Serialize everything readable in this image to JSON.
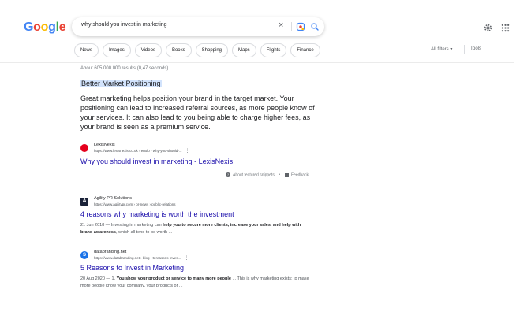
{
  "logo": {
    "text": "Google",
    "letters": [
      "G",
      "o",
      "o",
      "g",
      "l",
      "e"
    ],
    "colors": [
      "#4285f4",
      "#ea4335",
      "#fbbc05",
      "#4285f4",
      "#34a853",
      "#ea4335"
    ]
  },
  "search": {
    "query": "why should you invest in marketing",
    "clear_icon": "×"
  },
  "filters": [
    "News",
    "Images",
    "Videos",
    "Books",
    "Shopping",
    "Maps",
    "Flights",
    "Finance"
  ],
  "toolbar": {
    "all_filters": "All filters ▾",
    "tools": "Tools"
  },
  "stats": "About 605 000 000 results (0,47 seconds)",
  "featured": {
    "highlight": "Better Market Positioning",
    "snippet": "Great marketing helps position your brand in the target market. Your positioning can lead to increased referral sources, as more people know of your services. It can also lead to you being able to charge higher fees, as your brand is seen as a premium service.",
    "source_name": "LexisNexis",
    "source_url": "https://www.lexisnexis.co.uk › enolo › why-you-should-...",
    "title": "Why you should invest in marketing - LexisNexis",
    "about": "About featured snippets",
    "dot": "•",
    "feedback": "Feedback",
    "favicon_color": "#e5001c"
  },
  "results": [
    {
      "source_name": "Agility PR Solutions",
      "source_url": "https://www.agilitypr.com › pr-news › public-relations",
      "title": "4 reasons why marketing is worth the investment",
      "date": "21 Jun 2018",
      "desc_a": " — Investing in marketing can ",
      "desc_b": "help you to secure more clients, increase your sales, and help with brand awareness",
      "desc_c": ", which all tend to be worth ...",
      "favicon_label": "A",
      "favicon_color": "#1a2238"
    },
    {
      "source_name": "databranding.net",
      "source_url": "https://www.databranding.net › blog › 5-reasons-inves...",
      "title": "5 Reasons to Invest in Marketing",
      "date": "20 Aug 2020",
      "desc_a": " — 1. ",
      "desc_b": "You show your product or service to many more people",
      "desc_c": " ... This is why marketing exists; to make more people know your company, your products or ...",
      "favicon_label": "S",
      "favicon_color": "#1a73e8"
    }
  ],
  "menu_dots": "⋮"
}
